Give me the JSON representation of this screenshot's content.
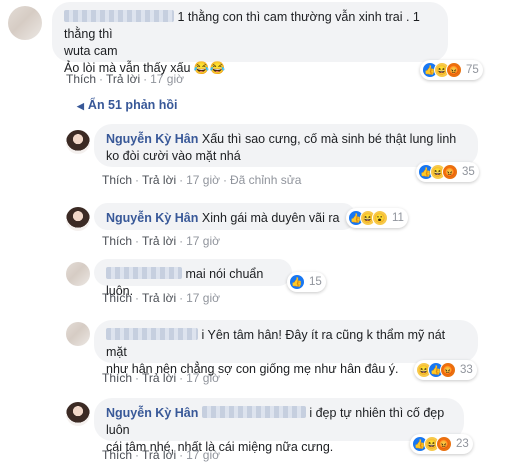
{
  "comments": [
    {
      "text_lines": [
        "1 thằng con thì cam thường vẫn xinh trai . 1 thằng thì",
        "wuta cam",
        "Ảo lòi mà vẫn thấy xấu 😂😂"
      ],
      "like": "Thích",
      "reply": "Trả lời",
      "time": "17 giờ",
      "reaction_count": "75"
    },
    {
      "name": "Nguyễn Kỳ Hân",
      "text_lines": [
        "Xấu thì sao cưng, cố mà sinh bé thật lung linh",
        "ko đòi cười vào mặt nhá"
      ],
      "like": "Thích",
      "reply": "Trả lời",
      "time": "17 giờ",
      "edited": "Đã chỉnh sửa",
      "reaction_count": "35"
    },
    {
      "name": "Nguyễn Kỳ Hân",
      "text_lines": [
        "Xinh gái mà duyên vãi ra"
      ],
      "like": "Thích",
      "reply": "Trả lời",
      "time": "17 giờ",
      "reaction_count": "11"
    },
    {
      "text_lines": [
        "mai nói chuẩn luôn."
      ],
      "like": "Thích",
      "reply": "Trả lời",
      "time": "17 giờ",
      "reaction_count": "15"
    },
    {
      "text_lines": [
        "i Yên tâm hân! Đây ít ra cũng k thẩm mỹ nát mặt",
        "như hân nên chẳng sợ con giống mẹ như hân đâu ý."
      ],
      "like": "Thích",
      "reply": "Trả lời",
      "time": "17 giờ",
      "reaction_count": "33"
    },
    {
      "name": "Nguyễn Kỳ Hân",
      "text_lines": [
        "i đẹp tự nhiên thì cố đẹp luôn",
        "cái tâm nhé, nhất là cái miệng nữa cưng."
      ],
      "like": "Thích",
      "reply": "Trả lời",
      "time": "17 giờ",
      "reaction_count": "23"
    }
  ],
  "replies_toggle": {
    "arrow": "◀",
    "label": "Ẩn 51 phản hồi"
  },
  "icons": {
    "like": "thumbs-up-icon",
    "haha": "haha-icon",
    "angry": "angry-icon",
    "wow": "wow-icon"
  },
  "colors": {
    "name": "#385898",
    "bubble": "#f2f3f5",
    "like": "#1877f2"
  }
}
